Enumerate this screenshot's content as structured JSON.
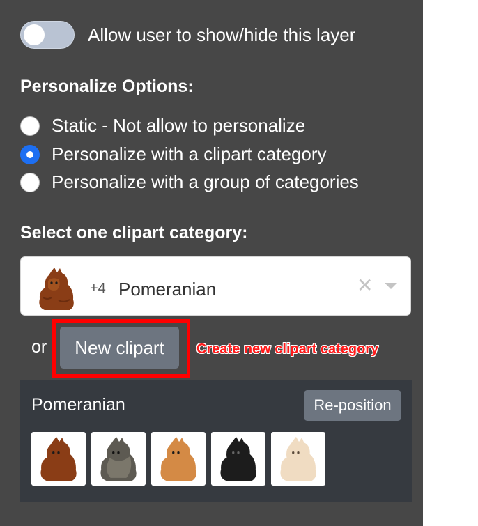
{
  "layer_toggle": {
    "label": "Allow user to show/hide this layer",
    "enabled": false,
    "track_color": "#b9c3d3"
  },
  "personalize": {
    "heading": "Personalize Options:",
    "options": [
      {
        "label": "Static - Not allow to personalize",
        "selected": false
      },
      {
        "label": "Personalize with a clipart category",
        "selected": true
      },
      {
        "label": "Personalize with a group of categories",
        "selected": false
      }
    ],
    "accent": "#1d6ff2"
  },
  "category_select": {
    "heading": "Select one clipart category:",
    "extra_count": "+4",
    "selected_value": "Pomeranian",
    "clear_icon": "close-icon",
    "dropdown_icon": "chevron-down-icon"
  },
  "new_clipart": {
    "or_text": "or",
    "button_label": "New clipart",
    "annotation": "Create new clipart category",
    "annotation_color": "#ff1a1a",
    "highlight_color": "#ff0000"
  },
  "category_panel": {
    "name": "Pomeranian",
    "reposition_label": "Re-position",
    "cliparts": [
      {
        "name": "pomeranian-red-clipart",
        "color": "#8a3d16"
      },
      {
        "name": "pomeranian-sable-clipart",
        "color": "#5d5a52"
      },
      {
        "name": "pomeranian-orange-clipart",
        "color": "#d48a45"
      },
      {
        "name": "pomeranian-black-clipart",
        "color": "#1c1c1c"
      },
      {
        "name": "pomeranian-cream-clipart",
        "color": "#f0dcc2"
      }
    ]
  }
}
